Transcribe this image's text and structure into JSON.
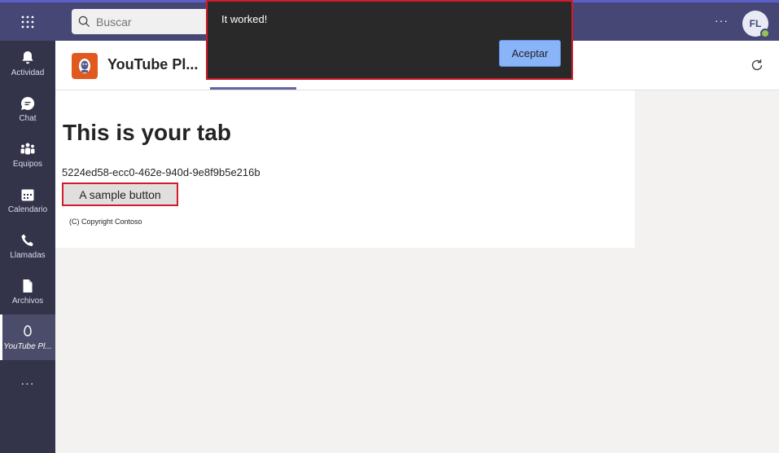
{
  "topbar": {
    "search_placeholder": "Buscar",
    "more_label": "···",
    "avatar_initials": "FL"
  },
  "rail": {
    "items": [
      {
        "label": "Actividad",
        "icon": "bell-icon"
      },
      {
        "label": "Chat",
        "icon": "chat-icon"
      },
      {
        "label": "Equipos",
        "icon": "teams-icon"
      },
      {
        "label": "Calendario",
        "icon": "calendar-icon"
      },
      {
        "label": "Llamadas",
        "icon": "phone-icon"
      },
      {
        "label": "Archivos",
        "icon": "file-icon"
      },
      {
        "label": "YouTube Pl...",
        "icon": "app-icon"
      }
    ],
    "more_label": "···"
  },
  "app": {
    "title": "YouTube Pl..."
  },
  "content": {
    "heading": "This is your tab",
    "guid": "5224ed58-ecc0-462e-940d-9e8f9b5e216b",
    "button_label": "A sample button",
    "copyright": "(C) Copyright Contoso"
  },
  "dialog": {
    "message": "It worked!",
    "ok_label": "Aceptar"
  },
  "colors": {
    "topbar": "#464775",
    "rail": "#33344a",
    "accent": "#6264a7",
    "highlight_border": "#d11c2a",
    "dialog_bg": "#292929",
    "dialog_button": "#8ab4f8"
  }
}
